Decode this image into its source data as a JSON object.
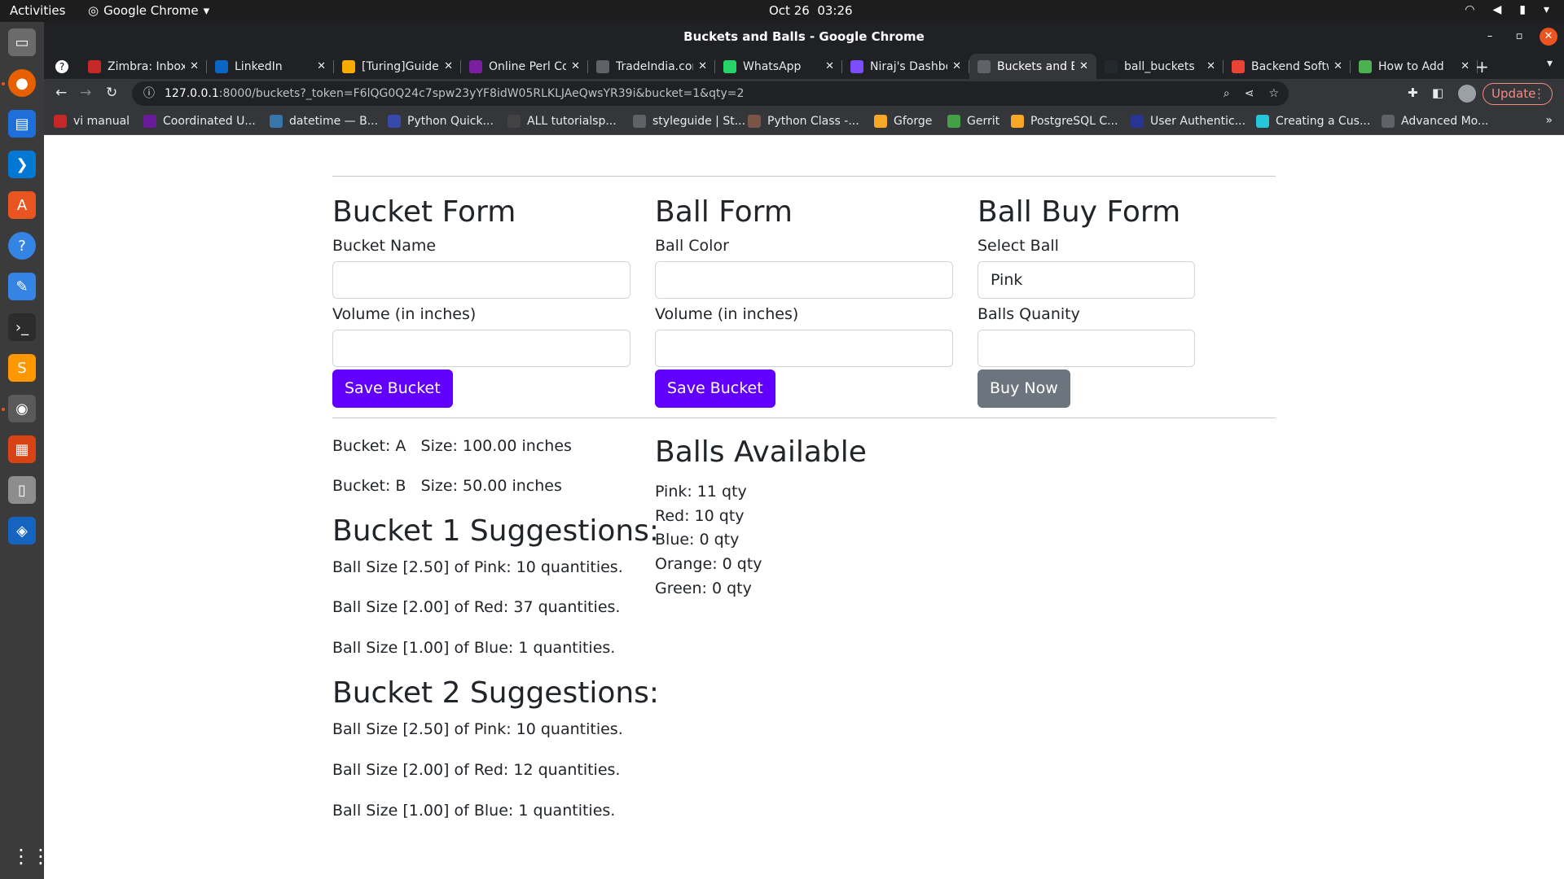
{
  "os": {
    "activities": "Activities",
    "app_name": "Google Chrome",
    "date": "Oct 26",
    "time": "03:26"
  },
  "window": {
    "title": "Buckets and Balls - Google Chrome"
  },
  "tabs": [
    {
      "label": "Zimbra: Inbox",
      "icon": "zimbra-icon"
    },
    {
      "label": "LinkedIn",
      "icon": "linkedin-icon"
    },
    {
      "label": "[Turing]Guide",
      "icon": "turing-icon"
    },
    {
      "label": "Online Perl Compiler",
      "icon": "perl-icon"
    },
    {
      "label": "TradeIndia.com",
      "icon": "globe-icon"
    },
    {
      "label": "WhatsApp",
      "icon": "whatsapp-icon"
    },
    {
      "label": "Niraj's Dashboard",
      "icon": "dashboard-icon"
    },
    {
      "label": "Buckets and Balls",
      "icon": "globe-icon",
      "active": true
    },
    {
      "label": "ball_buckets",
      "icon": "github-icon"
    },
    {
      "label": "Backend Software",
      "icon": "gmail-icon"
    },
    {
      "label": "How to Add",
      "icon": "link-icon"
    }
  ],
  "address": {
    "host": "127.0.0.1",
    "rest": ":8000/buckets?_token=F6lQG0Q24c7spw23yYF8idW05RLKLJAeQwsYR39i&bucket=1&qty=2"
  },
  "update_label": "Update",
  "bookmarks": [
    {
      "label": "vi manual",
      "color": "#c62828"
    },
    {
      "label": "Coordinated U...",
      "color": "#6a1b9a"
    },
    {
      "label": "datetime — B...",
      "color": "#3776ab"
    },
    {
      "label": "Python Quick...",
      "color": "#3949ab"
    },
    {
      "label": "ALL tutorialsp...",
      "color": "#424242"
    },
    {
      "label": "styleguide | St...",
      "color": "#5f6368"
    },
    {
      "label": "Python Class -...",
      "color": "#795548"
    },
    {
      "label": "Gforge",
      "color": "#f9a825"
    },
    {
      "label": "Gerrit",
      "color": "#43a047"
    },
    {
      "label": "PostgreSQL C...",
      "color": "#f9a825"
    },
    {
      "label": "User Authentic...",
      "color": "#283593"
    },
    {
      "label": "Creating a Cus...",
      "color": "#26c6da"
    },
    {
      "label": "Advanced Mo...",
      "color": "#5f6368"
    }
  ],
  "bucket_form": {
    "title": "Bucket Form",
    "name_label": "Bucket Name",
    "name_value": "",
    "volume_label": "Volume (in inches)",
    "volume_value": "",
    "button": "Save Bucket"
  },
  "ball_form": {
    "title": "Ball Form",
    "color_label": "Ball Color",
    "color_value": "",
    "volume_label": "Volume (in inches)",
    "volume_value": "",
    "button": "Save Bucket"
  },
  "buy_form": {
    "title": "Ball Buy Form",
    "select_label": "Select Ball",
    "selected": "Pink",
    "qty_label": "Balls Quanity",
    "qty_value": "",
    "button": "Buy Now"
  },
  "buckets": [
    "Bucket: A   Size: 100.00 inches",
    "Bucket: B   Size: 50.00 inches"
  ],
  "suggestions": [
    {
      "title": "Bucket 1 Suggestions:",
      "items": [
        "Ball Size [2.50] of Pink: 10 quantities.",
        "Ball Size [2.00] of Red: 37 quantities.",
        "Ball Size [1.00] of Blue: 1 quantities."
      ]
    },
    {
      "title": "Bucket 2 Suggestions:",
      "items": [
        "Ball Size [2.50] of Pink: 10 quantities.",
        "Ball Size [2.00] of Red: 12 quantities.",
        "Ball Size [1.00] of Blue: 1 quantities."
      ]
    }
  ],
  "balls_available": {
    "title": "Balls Available",
    "items": [
      "Pink: 11 qty",
      "Red: 10 qty",
      "Blue: 0 qty",
      "Orange: 0 qty",
      "Green: 0 qty"
    ]
  },
  "colors": {
    "accent": "#6200ff",
    "secondary": "#6c757d"
  }
}
